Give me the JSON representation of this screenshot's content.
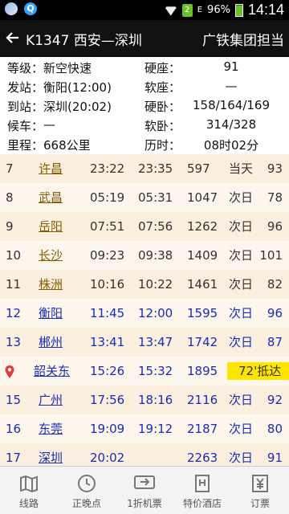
{
  "status_bar": {
    "sim_label": "2",
    "network_label": "E",
    "battery": "96%",
    "time": "14:14"
  },
  "header": {
    "title": "K1347 西安—深圳",
    "operator": "广铁集团担当"
  },
  "info": {
    "rows": [
      {
        "k1": "等级：",
        "v1": "新空快速",
        "k2": "硬座：",
        "v2": "91"
      },
      {
        "k1": "发站：",
        "v1": "衡阳(12:00)",
        "k2": "软座：",
        "v2": "—"
      },
      {
        "k1": "到站：",
        "v1": "深圳(20:02)",
        "k2": "硬卧：",
        "v2": "158/164/169"
      },
      {
        "k1": "候车：",
        "v1": "—",
        "k2": "软卧：",
        "v2": "314/328"
      },
      {
        "k1": "里程：",
        "v1": "668公里",
        "k2": "历时：",
        "v2": "08时02分"
      }
    ]
  },
  "stops": [
    {
      "num": "7",
      "station": "许昌",
      "arr": "23:22",
      "dep": "23:35",
      "km": "597",
      "day": "当天",
      "price": "93"
    },
    {
      "num": "8",
      "station": "武昌",
      "arr": "05:19",
      "dep": "05:31",
      "km": "1047",
      "day": "次日",
      "price": "78"
    },
    {
      "num": "9",
      "station": "岳阳",
      "arr": "07:51",
      "dep": "07:56",
      "km": "1262",
      "day": "次日",
      "price": "96"
    },
    {
      "num": "10",
      "station": "长沙",
      "arr": "09:23",
      "dep": "09:38",
      "km": "1409",
      "day": "次日",
      "price": "101"
    },
    {
      "num": "11",
      "station": "株洲",
      "arr": "10:16",
      "dep": "10:22",
      "km": "1461",
      "day": "次日",
      "price": "82"
    },
    {
      "num": "12",
      "station": "衡阳",
      "arr": "11:45",
      "dep": "12:00",
      "km": "1595",
      "day": "次日",
      "price": "96"
    },
    {
      "num": "13",
      "station": "郴州",
      "arr": "13:41",
      "dep": "13:47",
      "km": "1742",
      "day": "次日",
      "price": "87"
    },
    {
      "num": "",
      "station": "韶关东",
      "arr": "15:26",
      "dep": "15:32",
      "km": "1895",
      "day": "",
      "price": "",
      "delay": "72'抵达"
    },
    {
      "num": "15",
      "station": "广州",
      "arr": "17:56",
      "dep": "18:16",
      "km": "2116",
      "day": "次日",
      "price": "92"
    },
    {
      "num": "16",
      "station": "东莞",
      "arr": "19:09",
      "dep": "19:12",
      "km": "2187",
      "day": "次日",
      "price": "80"
    },
    {
      "num": "17",
      "station": "深圳",
      "arr": "20:02",
      "dep": "",
      "km": "2263",
      "day": "次日",
      "price": "91"
    }
  ],
  "nav": {
    "items": [
      {
        "label": "线路",
        "icon": "map-icon"
      },
      {
        "label": "正晚点",
        "icon": "clock-icon"
      },
      {
        "label": "1折机票",
        "icon": "plane-ticket-icon"
      },
      {
        "label": "特价酒店",
        "icon": "hotel-icon"
      },
      {
        "label": "订票",
        "icon": "ticket-icon"
      }
    ]
  },
  "colors": {
    "passed_text": "#333333",
    "future_text": "#1a2bb8",
    "delay_badge": "#ffe600",
    "row_odd": "#fbefe0",
    "row_even": "#fdf6ec"
  }
}
